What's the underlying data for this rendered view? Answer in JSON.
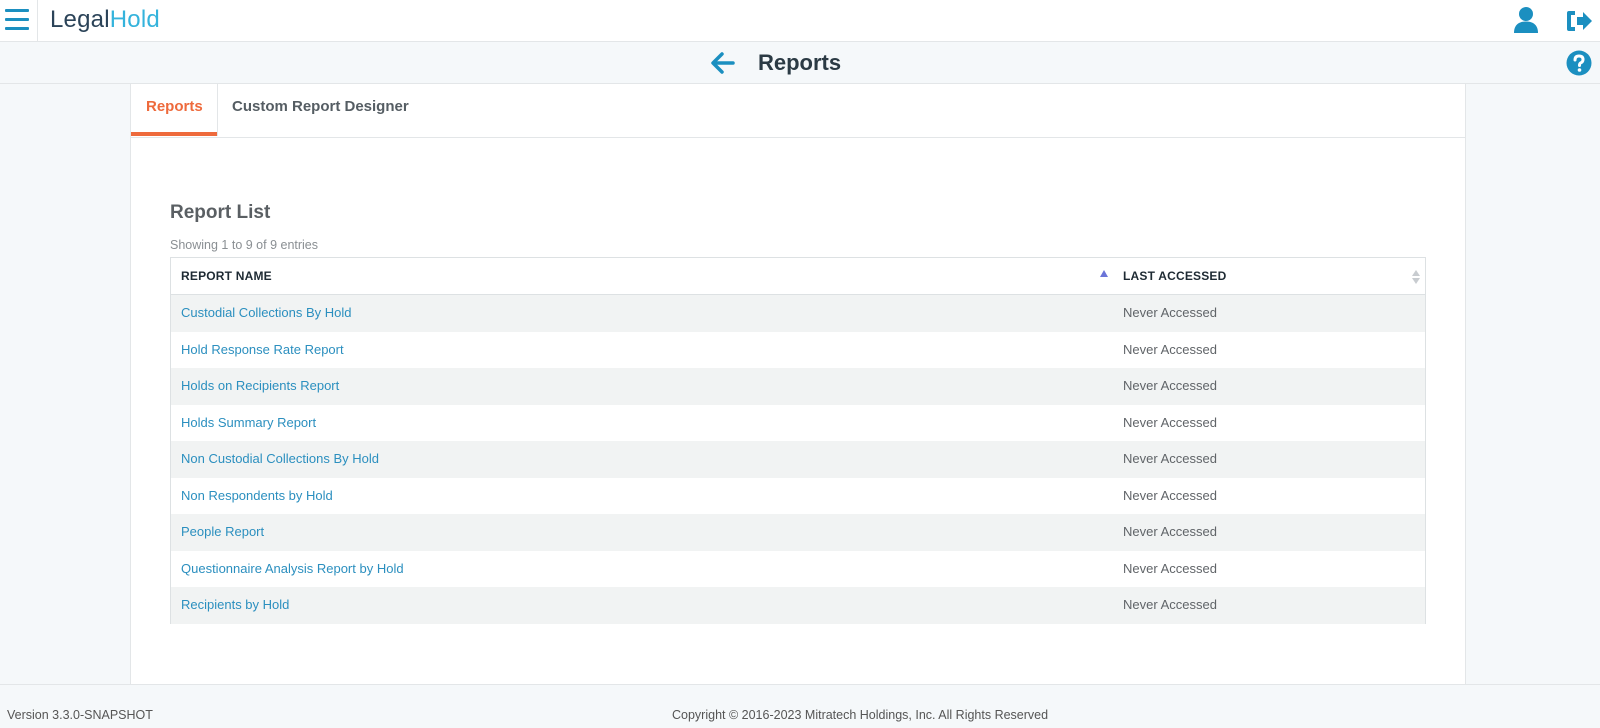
{
  "header": {
    "logo_part1": "Legal",
    "logo_part2": "Hold"
  },
  "titlebar": {
    "title": "Reports"
  },
  "tabs": [
    {
      "label": "Reports",
      "active": true
    },
    {
      "label": "Custom Report Designer",
      "active": false
    }
  ],
  "report_list": {
    "title": "Report List",
    "entries_info": "Showing 1 to 9 of 9 entries",
    "columns": [
      "REPORT NAME",
      "LAST ACCESSED"
    ],
    "rows": [
      {
        "name": "Custodial Collections By Hold",
        "last_accessed": "Never Accessed"
      },
      {
        "name": "Hold Response Rate Report",
        "last_accessed": "Never Accessed"
      },
      {
        "name": "Holds on Recipients Report",
        "last_accessed": "Never Accessed"
      },
      {
        "name": "Holds Summary Report",
        "last_accessed": "Never Accessed"
      },
      {
        "name": "Non Custodial Collections By Hold",
        "last_accessed": "Never Accessed"
      },
      {
        "name": "Non Respondents by Hold",
        "last_accessed": "Never Accessed"
      },
      {
        "name": "People Report",
        "last_accessed": "Never Accessed"
      },
      {
        "name": "Questionnaire Analysis Report by Hold",
        "last_accessed": "Never Accessed"
      },
      {
        "name": "Recipients by Hold",
        "last_accessed": "Never Accessed"
      }
    ]
  },
  "footer": {
    "version": "Version 3.3.0-SNAPSHOT",
    "copyright": "Copyright © 2016-2023 Mitratech Holdings, Inc. All Rights Reserved"
  },
  "icons": {
    "menu": "hamburger-menu-icon",
    "user": "user-icon",
    "logout": "logout-icon",
    "back": "back-arrow-icon",
    "help": "help-icon",
    "sort_asc": "sort-ascending-icon",
    "sort": "sort-icon"
  },
  "colors": {
    "brand_dark": "#2b4358",
    "brand_light": "#34b3dc",
    "accent_tab": "#ee6a3c",
    "link": "#2b8fbf",
    "icon": "#1b8fc0"
  }
}
